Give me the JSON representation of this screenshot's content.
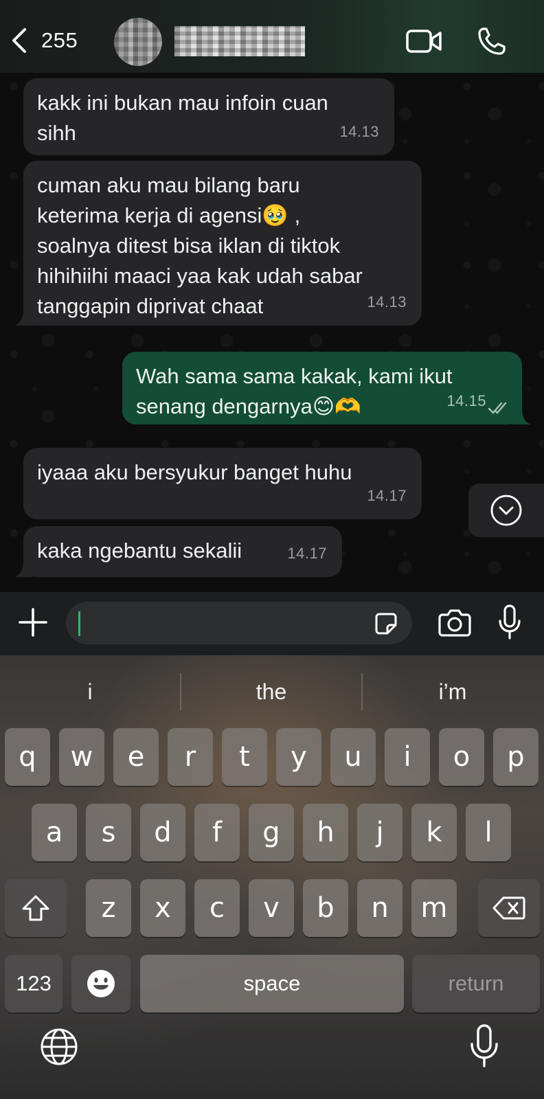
{
  "header": {
    "back_count": "255",
    "icons": [
      "chevron-left-icon",
      "video-icon",
      "phone-icon"
    ]
  },
  "messages": [
    {
      "direction": "in",
      "text": "kakk ini bukan mau infoin cuan\nsihh",
      "time": "14.13"
    },
    {
      "direction": "in",
      "text": "cuman aku mau bilang baru\nketerima kerja di agensi🥹 ,\nsoalnya ditest bisa iklan di tiktok\nhihihiihi maaci yaa kak udah sabar\ntanggapin diprivat chaat",
      "time": "14.13"
    },
    {
      "direction": "out",
      "text": "Wah sama sama kakak, kami ikut\nsenang dengarnya😊🫶",
      "time": "14.15",
      "status": "read"
    },
    {
      "direction": "in",
      "text": "iyaaa aku bersyukur banget huhu",
      "time": "14.17"
    },
    {
      "direction": "in",
      "text": "kaka ngebantu sekalii",
      "time": "14.17"
    }
  ],
  "composer": {
    "value": "",
    "icons": [
      "plus-icon",
      "sticker-icon",
      "camera-icon",
      "microphone-icon"
    ]
  },
  "keyboard": {
    "suggestions": [
      "i",
      "the",
      "i’m"
    ],
    "row1": [
      "q",
      "w",
      "e",
      "r",
      "t",
      "y",
      "u",
      "i",
      "o",
      "p"
    ],
    "row2": [
      "a",
      "s",
      "d",
      "f",
      "g",
      "h",
      "j",
      "k",
      "l"
    ],
    "row3": [
      "z",
      "x",
      "c",
      "v",
      "b",
      "n",
      "m"
    ],
    "numbers_label": "123",
    "space_label": "space",
    "return_label": "return",
    "icons": [
      "shift-icon",
      "backspace-icon",
      "emoji-icon",
      "globe-icon",
      "dictation-mic-icon"
    ]
  }
}
